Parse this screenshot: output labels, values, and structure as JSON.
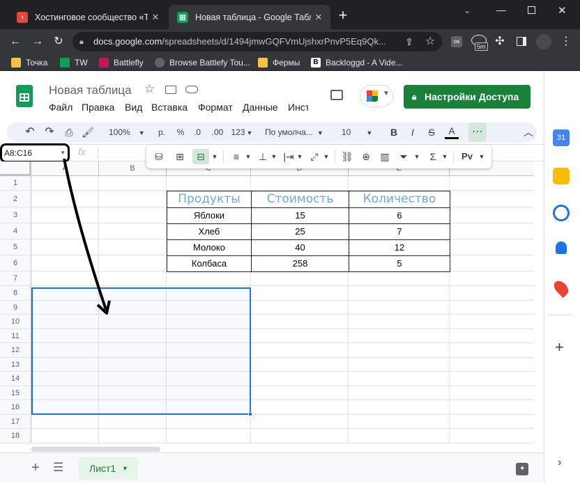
{
  "browser": {
    "tabs": [
      {
        "title": "Хостинговое сообщество «Time",
        "active": false
      },
      {
        "title": "Новая таблица - Google Таблицы",
        "active": true
      }
    ],
    "new_tab": "+",
    "url_host": "docs.google.com",
    "url_path": "/spreadsheets/d/1494jmwGQFVmUjshxrPnvP5Eq9Qk...",
    "ext_badge": "5m",
    "bookmarks": [
      {
        "label": "Точка",
        "color": "#f6c443"
      },
      {
        "label": "TW",
        "color": "#0f9d58"
      },
      {
        "label": "Battlefly",
        "color": "#c2185b"
      },
      {
        "label": "Browse Battlefy Tou...",
        "color": "#5f6368"
      },
      {
        "label": "Фермы",
        "color": "#f6c443"
      },
      {
        "label": "Backloggd - A Vide...",
        "color": "#ffffff"
      }
    ]
  },
  "sheets": {
    "doc_title": "Новая таблица",
    "menu": [
      "Файл",
      "Правка",
      "Вид",
      "Вставка",
      "Формат",
      "Данные",
      "Инст"
    ],
    "share_label": "Настройки Доступа",
    "toolbar": {
      "zoom": "100%",
      "currency": "р.",
      "percent": "%",
      "dec_less": ".0",
      "dec_more": ".00",
      "format_more": "123",
      "font": "По умолча...",
      "font_size": "10",
      "bold": "B",
      "italic": "I",
      "strike": "S",
      "text_color": "A",
      "more": "⋯"
    },
    "float_input_tools": "Рv",
    "name_box": "A8:C16",
    "fx": "fx",
    "columns": [
      "A",
      "B",
      "C",
      "D",
      "E"
    ],
    "rows": [
      "1",
      "2",
      "3",
      "4",
      "5",
      "6",
      "7",
      "8",
      "9",
      "10",
      "11",
      "12",
      "13",
      "14",
      "15",
      "16",
      "17",
      "18"
    ],
    "table": {
      "headers": [
        "Продукты",
        "Стоимость",
        "Количество"
      ],
      "rows": [
        [
          "Яблоки",
          "15",
          "6"
        ],
        [
          "Хлеб",
          "25",
          "7"
        ],
        [
          "Молоко",
          "40",
          "12"
        ],
        [
          "Колбаса",
          "258",
          "5"
        ]
      ]
    },
    "sheet_tab": "Лист1",
    "add_sheet": "+",
    "accent": "#188038",
    "selection_color": "#1a73e8"
  }
}
